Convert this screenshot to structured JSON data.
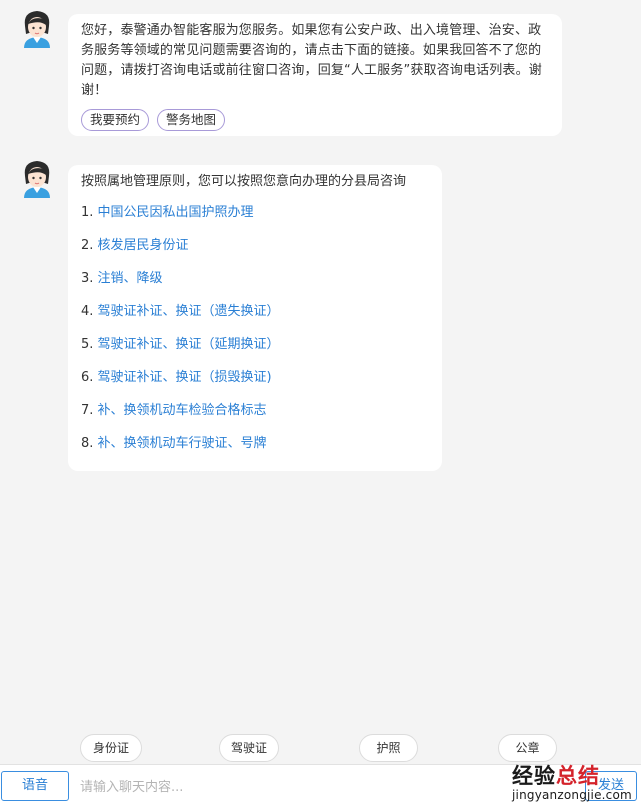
{
  "greeting": {
    "text": "您好，泰警通办智能客服为您服务。如果您有公安户政、出入境管理、治安、政务服务等领域的常见问题需要咨询的，请点击下面的链接。如果我回答不了您的问题，请拨打咨询电话或前往窗口咨询，回复“人工服务”获取咨询电话列表。谢谢！",
    "buttons": [
      "我要预约",
      "警务地图"
    ]
  },
  "reply": {
    "intro": "按照属地管理原则，您可以按照您意向办理的分县局咨询",
    "links": [
      {
        "num": "1.",
        "label": "中国公民因私出国护照办理"
      },
      {
        "num": "2.",
        "label": "核发居民身份证"
      },
      {
        "num": "3.",
        "label": "注销、降级"
      },
      {
        "num": "4.",
        "label": "驾驶证补证、换证（遗失换证）"
      },
      {
        "num": "5.",
        "label": "驾驶证补证、换证（延期换证）"
      },
      {
        "num": "6.",
        "label": "驾驶证补证、换证（损毁换证)"
      },
      {
        "num": "7.",
        "label": "补、换领机动车检验合格标志"
      },
      {
        "num": "8.",
        "label": "补、换领机动车行驶证、号牌"
      }
    ]
  },
  "quick_replies": [
    "身份证",
    "驾驶证",
    "护照",
    "公章"
  ],
  "input_bar": {
    "voice_label": "语音",
    "placeholder": "请输入聊天内容...",
    "send_label": "发送"
  },
  "watermark": {
    "cn_part1": "经验",
    "cn_part2": "总结",
    "en": "jingyanzongjie.com"
  },
  "colors": {
    "background": "#f4f4f4",
    "link": "#2a7fd4",
    "pill_border": "#a89ad8",
    "accent_blue": "#3a8ee0"
  },
  "icons": {
    "avatar": "customer-service-agent-avatar"
  }
}
